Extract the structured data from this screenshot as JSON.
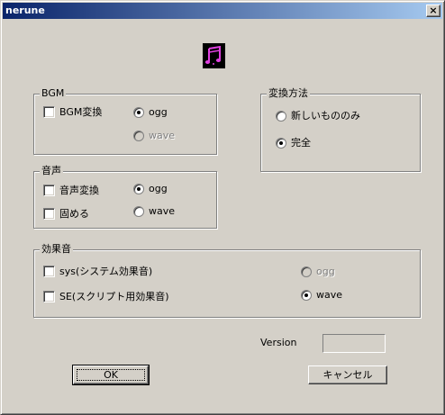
{
  "window": {
    "title": "nerune",
    "close_glyph": "×"
  },
  "app_icon": {
    "name": "music-note-icon",
    "color": "#e040e0"
  },
  "bgm": {
    "legend": "BGM",
    "convert_label": "BGM変換",
    "ogg_label": "ogg",
    "wave_label": "wave"
  },
  "voice": {
    "legend": "音声",
    "convert_label": "音声変換",
    "pack_label": "固める",
    "ogg_label": "ogg",
    "wave_label": "wave"
  },
  "method": {
    "legend": "変換方法",
    "new_only_label": "新しいもののみ",
    "full_label": "完全"
  },
  "sfx": {
    "legend": "効果音",
    "sys_label": "sys(システム効果音)",
    "se_label": "SE(スクリプト用効果音)",
    "ogg_label": "ogg",
    "wave_label": "wave"
  },
  "version": {
    "label": "Version",
    "value": ""
  },
  "buttons": {
    "ok": "OK",
    "cancel": "キャンセル"
  }
}
